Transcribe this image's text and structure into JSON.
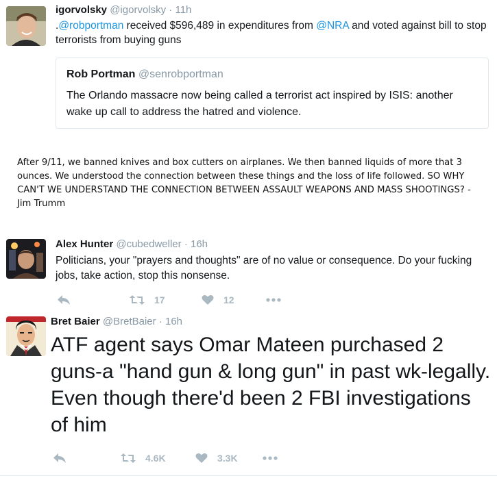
{
  "tweet1": {
    "name": "igorvolsky",
    "handle": "@igorvolsky",
    "sep": "·",
    "time": "11h",
    "text_parts": [
      ".",
      "@robportman",
      " received $596,489 in expenditures from ",
      "@NRA",
      " and voted against bill to stop terrorists from buying guns"
    ],
    "quote": {
      "name": "Rob Portman",
      "handle": "@senrobportman",
      "text": "The Orlando massacre now being called a terrorist act inspired by ISIS: another wake up call to address the hatred and violence."
    }
  },
  "comment": {
    "text": "After 9/11, we banned knives and box cutters on airplanes. We then banned liquids of more that 3 ounces. We understood the connection between these things and the loss of life followed. SO WHY CAN'T WE UNDERSTAND THE CONNECTION BETWEEN ASSAULT WEAPONS AND MASS SHOOTINGS? - Jim Trumm"
  },
  "tweet2": {
    "name": "Alex Hunter",
    "handle": "@cubedweller",
    "sep": "·",
    "time": "16h",
    "text": "Politicians, your \"prayers and thoughts\" are of no value or consequence. Do your fucking jobs, take action, stop this nonsense.",
    "retweets": "17",
    "likes": "12"
  },
  "tweet3": {
    "name": "Bret Baier",
    "handle": "@BretBaier",
    "sep": "·",
    "time": "16h",
    "text": "ATF agent says Omar Mateen purchased 2 guns-a \"hand gun & long gun\" in past wk-legally. Even though there'd been 2 FBI investigations of him",
    "retweets": "4.6K",
    "likes": "3.3K"
  },
  "icons": [
    "reply-icon",
    "retweet-icon",
    "like-icon",
    "more-icon"
  ],
  "colors": {
    "link": "#1b95e0",
    "muted": "#8899a6",
    "action": "#aab8c2"
  }
}
